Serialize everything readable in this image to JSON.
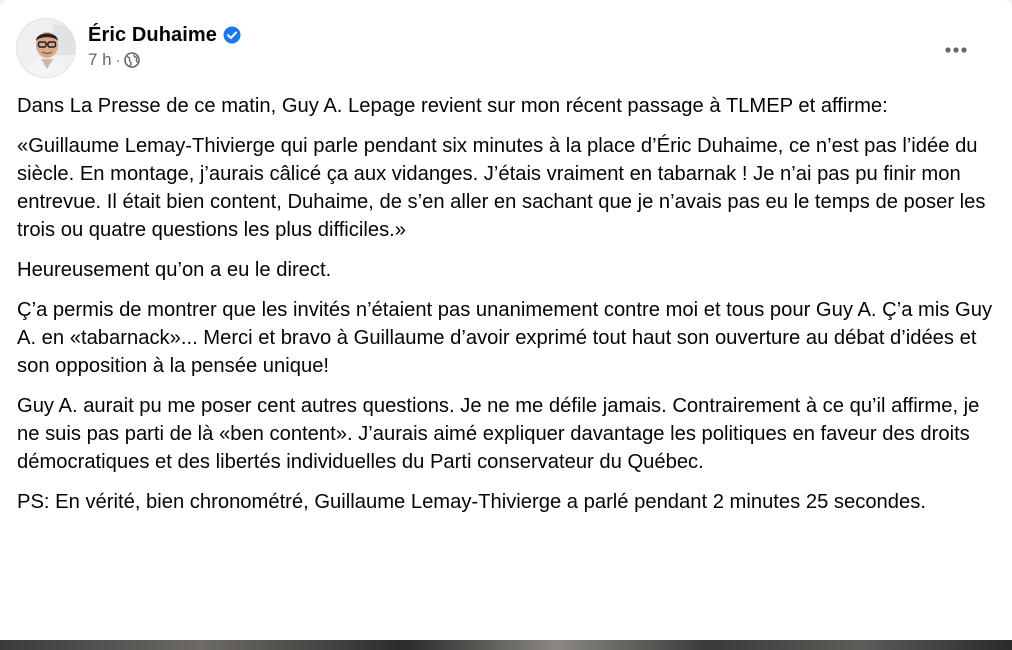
{
  "post": {
    "author": {
      "name": "Éric Duhaime",
      "verified": true,
      "verified_icon": "verified-badge-icon",
      "avatar_icon": "profile-photo"
    },
    "meta": {
      "time": "7 h",
      "separator": "·",
      "audience_icon": "globe-icon"
    },
    "more_icon": "more-options-icon",
    "paragraphs": [
      "Dans La Presse de ce matin, Guy A. Lepage revient sur mon récent passage à TLMEP et affirme:",
      "«Guillaume Lemay-Thivierge qui parle pendant six minutes à la place d’Éric Duhaime, ce n’est pas l’idée du siècle. En montage, j’aurais câlicé ça aux vidanges. J’étais vraiment en tabarnak ! Je n’ai pas pu finir mon entrevue. Il était bien content, Duhaime, de s’en aller en sachant que je n’avais pas eu le temps de poser les trois ou quatre questions les plus difficiles.»",
      "Heureusement qu’on a eu le direct.",
      "Ç’a permis de montrer que les invités n’étaient pas unanimement contre moi et tous pour Guy A. Ç’a mis Guy A. en «tabarnack»... Merci et bravo à Guillaume d’avoir exprimé tout haut son ouverture au débat d’idées et son opposition à la pensée unique!",
      "Guy A. aurait pu me poser cent autres questions. Je ne me défile jamais. Contrairement à ce qu’il affirme, je ne suis pas parti de là «ben content». J’aurais aimé expliquer davantage les politiques en faveur des droits démocratiques et des libertés individuelles du Parti conservateur du Québec.",
      "PS: En vérité, bien chronométré, Guillaume Lemay-Thivierge a parlé pendant 2 minutes 25 secondes."
    ]
  },
  "colors": {
    "verified_blue": "#1877f2",
    "secondary_text": "#65676b",
    "primary_text": "#050505"
  }
}
